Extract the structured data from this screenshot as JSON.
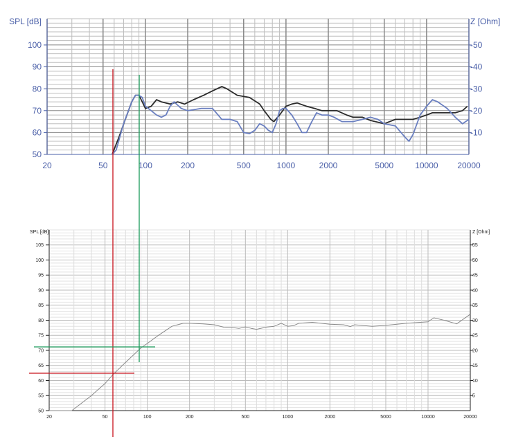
{
  "chart_data": [
    {
      "type": "line",
      "title": "",
      "ylabel": "SPL [dB]",
      "y2label": "Z [Ohm]",
      "xscale": "log",
      "xlim": [
        20,
        20000
      ],
      "ylim": [
        50,
        112
      ],
      "y2lim": [
        0,
        62
      ],
      "grid": true,
      "xticks": [
        20,
        50,
        100,
        200,
        500,
        1000,
        2000,
        5000,
        10000,
        20000
      ],
      "yticks": [
        50,
        60,
        70,
        80,
        90,
        100
      ],
      "y2ticks": [
        10,
        20,
        30,
        40,
        50
      ],
      "axis_color": "#4a5fa8",
      "series": [
        {
          "name": "black curve",
          "color": "#2b2b2b",
          "x": [
            58,
            65,
            72,
            80,
            85,
            90,
            95,
            100,
            110,
            120,
            130,
            150,
            170,
            190,
            220,
            260,
            300,
            350,
            380,
            450,
            550,
            650,
            700,
            780,
            820,
            900,
            1000,
            1100,
            1200,
            1400,
            1600,
            1800,
            2000,
            2300,
            2700,
            3000,
            3500,
            4000,
            5000,
            6000,
            7000,
            8000,
            9000,
            10000,
            11000,
            13000,
            16000,
            18000,
            19500
          ],
          "y": [
            50,
            58,
            66,
            74,
            77,
            77,
            74,
            71,
            72,
            75,
            74,
            73,
            74,
            73,
            75,
            77,
            79,
            81,
            80,
            77,
            76,
            73,
            70,
            66,
            65,
            68,
            72,
            73,
            73.5,
            72,
            71,
            70,
            70,
            70,
            68,
            67,
            67,
            65.5,
            64,
            66,
            66,
            66,
            67,
            68,
            69,
            69,
            69,
            70,
            72
          ]
        },
        {
          "name": "blue curve",
          "color": "#6a7fc0",
          "x": [
            58,
            62,
            70,
            80,
            85,
            90,
            95,
            100,
            110,
            120,
            130,
            140,
            150,
            160,
            180,
            200,
            250,
            300,
            350,
            400,
            450,
            500,
            550,
            600,
            650,
            700,
            750,
            800,
            850,
            900,
            950,
            1000,
            1100,
            1200,
            1300,
            1400,
            1500,
            1650,
            1800,
            2000,
            2200,
            2500,
            3000,
            3500,
            4000,
            4500,
            5000,
            6000,
            7000,
            7500,
            8000,
            9000,
            10000,
            11000,
            12000,
            14000,
            16000,
            18000,
            20000
          ],
          "y": [
            50,
            52,
            64,
            74,
            77,
            77,
            76,
            72,
            70,
            68,
            67,
            68,
            72,
            74,
            71,
            70,
            71,
            71,
            66,
            66,
            65,
            60,
            59.5,
            61,
            64,
            63,
            61,
            60,
            64,
            70,
            71,
            71,
            68,
            64,
            60,
            60,
            64,
            69,
            68,
            68,
            67,
            65,
            65,
            66,
            67,
            66,
            64,
            63,
            58,
            56,
            59,
            68,
            72,
            75,
            74,
            71,
            67,
            64,
            66
          ]
        }
      ]
    },
    {
      "type": "line",
      "title": "",
      "ylabel": "SPL [dB]",
      "y2label": "Z [Ohm]",
      "xscale": "log",
      "xlim": [
        20,
        20000
      ],
      "ylim": [
        50,
        110
      ],
      "y2lim": [
        0,
        60
      ],
      "grid": true,
      "xticks": [
        20,
        50,
        100,
        200,
        500,
        1000,
        2000,
        5000,
        10000,
        20000
      ],
      "yticks": [
        50,
        55,
        60,
        65,
        70,
        75,
        80,
        85,
        90,
        95,
        100,
        105
      ],
      "y2ticks": [
        5,
        10,
        15,
        20,
        25,
        30,
        35,
        40,
        45,
        50,
        55
      ],
      "axis_color": "#222222",
      "series": [
        {
          "name": "grey curve",
          "color": "#8a8a8a",
          "x": [
            20,
            29,
            40,
            50,
            57,
            70,
            90,
            100,
            120,
            150,
            180,
            200,
            250,
            300,
            350,
            400,
            450,
            500,
            550,
            600,
            700,
            800,
            900,
            1000,
            1100,
            1200,
            1500,
            2000,
            2500,
            2800,
            3000,
            4000,
            5000,
            7000,
            10000,
            11000,
            13000,
            16000,
            20000
          ],
          "y": [
            50,
            50,
            55,
            59,
            62,
            66,
            70.8,
            72.3,
            75,
            78,
            79,
            79,
            78.8,
            78.5,
            77.7,
            77.6,
            77.3,
            77.8,
            77.3,
            77,
            77.7,
            78,
            79,
            78,
            78.2,
            79,
            79.3,
            78.7,
            78.5,
            77.9,
            78.5,
            78,
            78.3,
            79,
            79.5,
            80.8,
            80,
            78.8,
            82
          ]
        }
      ]
    }
  ],
  "markers": {
    "red": "#c8101a",
    "green": "#1a9a5a",
    "red_value_hz": 57,
    "green_value_hz": 90,
    "red_spl_db": 62,
    "green_spl_db": 71
  }
}
